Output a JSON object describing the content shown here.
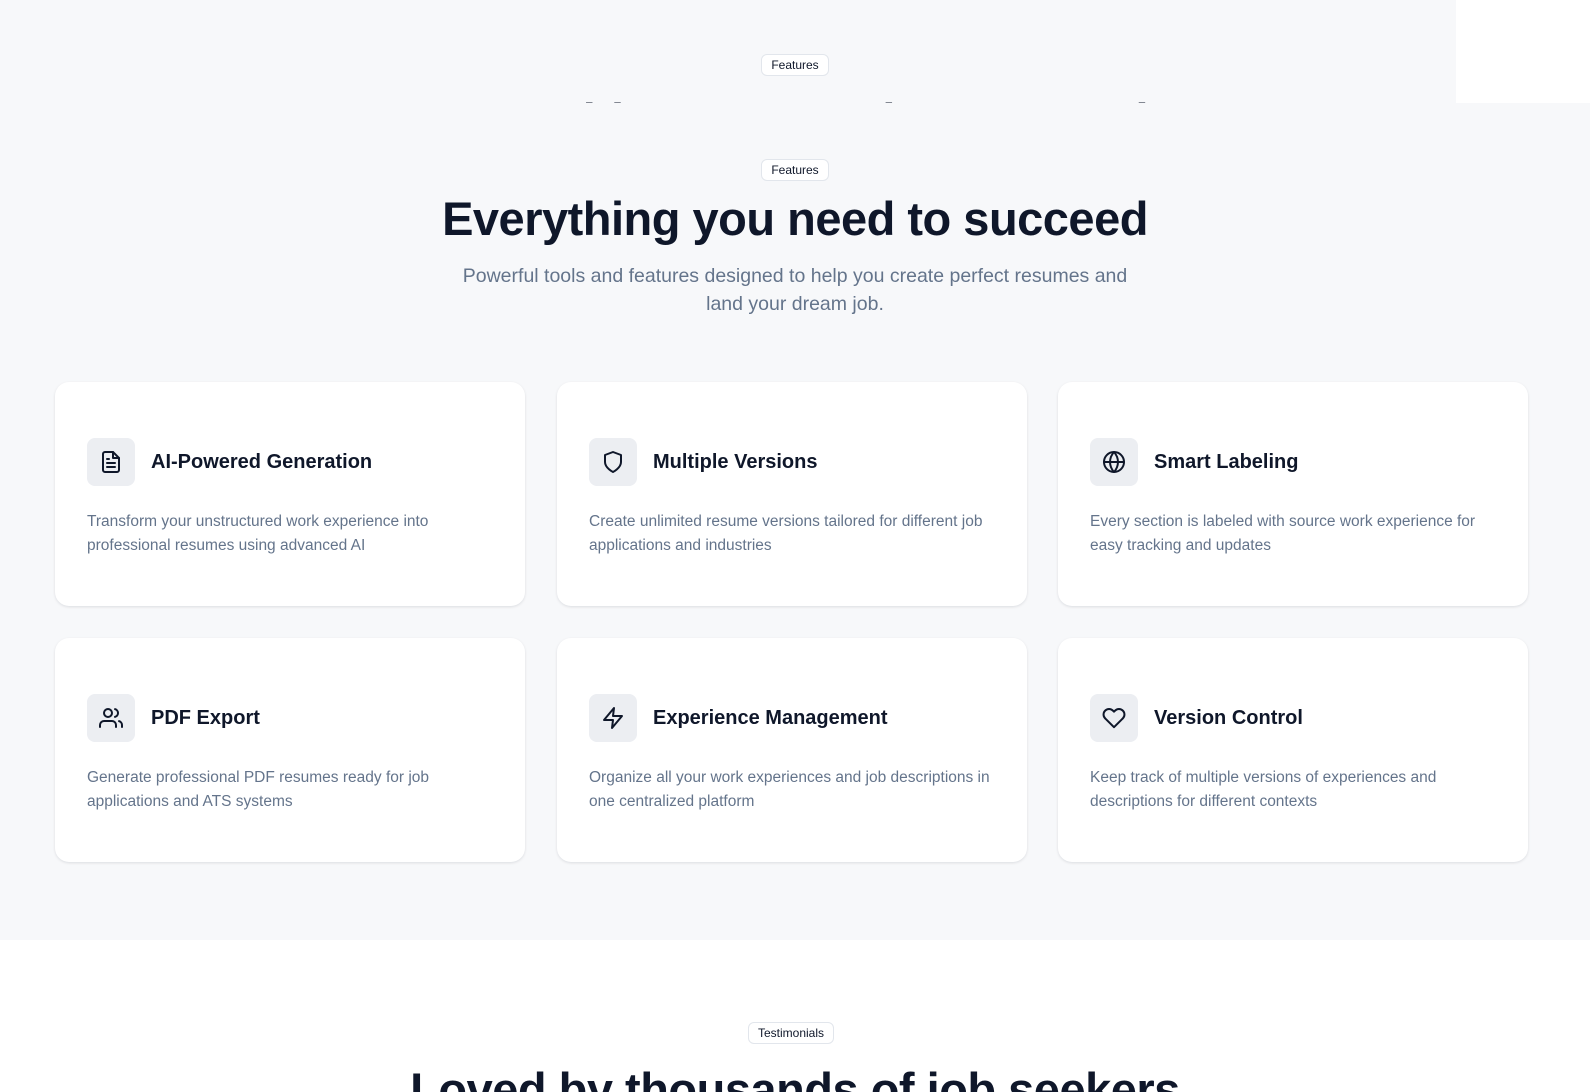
{
  "top_partial": {
    "badge": "Features",
    "heading": "Everything you need to succeed"
  },
  "features": {
    "badge": "Features",
    "title": "Everything you need to succeed",
    "subtitle": "Powerful tools and features designed to help you create perfect resumes and land your dream job.",
    "cards": [
      {
        "icon": "file-text-icon",
        "title": "AI-Powered Generation",
        "description": "Transform your unstructured work experience into professional resumes using advanced AI"
      },
      {
        "icon": "shield-icon",
        "title": "Multiple Versions",
        "description": "Create unlimited resume versions tailored for different job applications and industries"
      },
      {
        "icon": "globe-icon",
        "title": "Smart Labeling",
        "description": "Every section is labeled with source work experience for easy tracking and updates"
      },
      {
        "icon": "users-icon",
        "title": "PDF Export",
        "description": "Generate professional PDF resumes ready for job applications and ATS systems"
      },
      {
        "icon": "zap-icon",
        "title": "Experience Management",
        "description": "Organize all your work experiences and job descriptions in one centralized platform"
      },
      {
        "icon": "heart-icon",
        "title": "Version Control",
        "description": "Keep track of multiple versions of experiences and descriptions for different contexts"
      }
    ]
  },
  "testimonials": {
    "badge": "Testimonials",
    "title": "Loved by thousands of job seekers"
  }
}
